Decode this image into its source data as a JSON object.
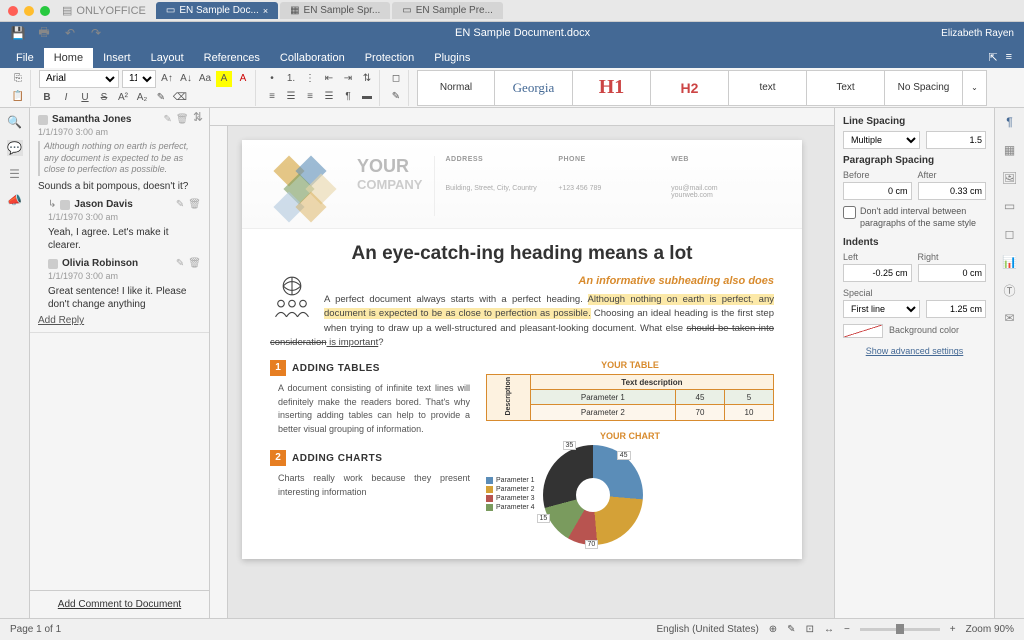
{
  "app": {
    "name": "ONLYOFFICE"
  },
  "tabs": [
    {
      "label": "EN Sample Doc...",
      "active": true
    },
    {
      "label": "EN Sample Spr..."
    },
    {
      "label": "EN Sample Pre..."
    }
  ],
  "header": {
    "title": "EN Sample Document.docx",
    "user": "Elizabeth Rayen"
  },
  "menu": [
    "File",
    "Home",
    "Insert",
    "Layout",
    "References",
    "Collaboration",
    "Protection",
    "Plugins"
  ],
  "activeMenu": "Home",
  "toolbar": {
    "font": "Arial",
    "size": "11"
  },
  "styles": [
    "Normal",
    "Georgia",
    "H1",
    "H2",
    "text",
    "Text",
    "No Spacing"
  ],
  "comments": {
    "main": {
      "author": "Samantha Jones",
      "date": "1/1/1970 3:00 am",
      "quote": "Although nothing on earth is perfect, any document is expected to be as close to perfection as possible.",
      "text": "Sounds a bit pompous, doesn't it?"
    },
    "replies": [
      {
        "author": "Jason Davis",
        "date": "1/1/1970 3:00 am",
        "text": "Yeah, I agree. Let's make it clearer."
      },
      {
        "author": "Olivia Robinson",
        "date": "1/1/1970 3:00 am",
        "text": "Great sentence! I like it. Please don't change anything"
      }
    ],
    "addReply": "Add Reply",
    "addComment": "Add Comment to Document"
  },
  "doc": {
    "companyYour": "YOUR",
    "companyCompany": "COMPANY",
    "contacts": {
      "addressLbl": "ADDRESS",
      "address": "Building, Street, City, Country",
      "phoneLbl": "PHONE",
      "phone": "+123 456 789",
      "webLbl": "WEB",
      "email": "you@mail.com",
      "site": "yourweb.com"
    },
    "h1": "An eye-catch-ing heading means a lot",
    "h2": "An informative subheading also does",
    "p1a": "A perfect document always starts with a perfect heading. ",
    "p1hl": "Although nothing on earth is perfect, any document is expected to be as close to perfection as possible.",
    "p1b": " Choosing an ideal heading is the first step when trying to draw up a well-structured and pleasant-looking document. What else ",
    "p1strike": "should be taken into consideration",
    "p1under": " is important",
    "sec1": {
      "n": "1",
      "title": "ADDING TABLES",
      "body": "A document consisting of infinite text lines will definitely make the readers bored. That's why inserting adding tables can help to provide a better visual grouping of information."
    },
    "sec2": {
      "n": "2",
      "title": "ADDING CHARTS",
      "body": "Charts really work because they present interesting information"
    },
    "tableTitle": "YOUR TABLE",
    "table": {
      "header": "Text description",
      "side": "Description",
      "rows": [
        [
          "Parameter 1",
          "45",
          "5"
        ],
        [
          "Parameter 2",
          "70",
          "10"
        ]
      ]
    },
    "chartTitle": "YOUR CHART",
    "legend": [
      "Parameter 1",
      "Parameter 2",
      "Parameter 3",
      "Parameter 4"
    ],
    "pieLabels": [
      "45",
      "35",
      "15",
      "70"
    ]
  },
  "rightPanel": {
    "lineSpacing": "Line Spacing",
    "lineMode": "Multiple",
    "lineVal": "1.5",
    "paraSpacing": "Paragraph Spacing",
    "before": "Before",
    "after": "After",
    "beforeVal": "0 cm",
    "afterVal": "0.33 cm",
    "dontAdd": "Don't add interval between paragraphs of the same style",
    "indents": "Indents",
    "left": "Left",
    "right": "Right",
    "leftVal": "-0.25 cm",
    "rightVal": "0 cm",
    "special": "Special",
    "specialMode": "First line",
    "specialVal": "1.25 cm",
    "bgColor": "Background color",
    "advanced": "Show advanced settings"
  },
  "status": {
    "page": "Page 1 of 1",
    "lang": "English (United States)",
    "zoom": "Zoom 90%"
  }
}
